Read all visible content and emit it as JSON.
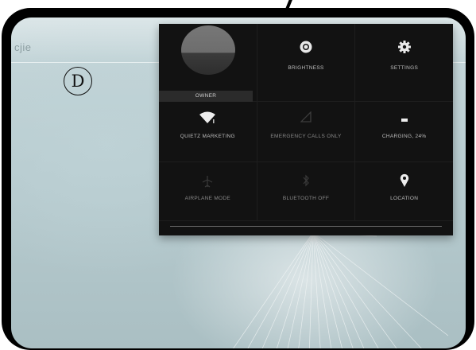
{
  "overlay": {
    "marker_letter": "D",
    "corner_logo": "cjie"
  },
  "quick_settings": {
    "owner": {
      "label": "OWNER"
    },
    "brightness": {
      "label": "BRIGHTNESS"
    },
    "settings": {
      "label": "SETTINGS"
    },
    "wifi": {
      "label": "QUIETZ MARKETING"
    },
    "cellular": {
      "label": "EMERGENCY CALLS ONLY"
    },
    "battery": {
      "label": "CHARGING, 24%",
      "level_percent": 24
    },
    "airplane": {
      "label": "AIRPLANE MODE"
    },
    "bluetooth": {
      "label": "BLUETOOTH OFF"
    },
    "location": {
      "label": "LOCATION"
    }
  },
  "icons": {
    "brightness": "brightness-icon",
    "settings": "gear-icon",
    "wifi": "wifi-icon",
    "cellular": "signal-icon",
    "battery": "battery-icon",
    "airplane": "airplane-icon",
    "bluetooth": "bluetooth-icon",
    "location": "location-pin-icon"
  }
}
